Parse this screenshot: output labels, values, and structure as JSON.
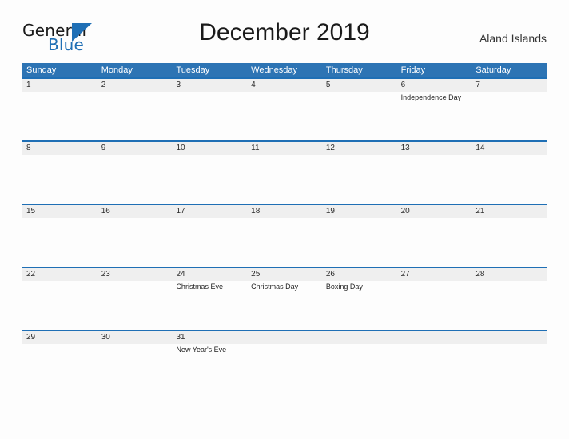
{
  "brand": {
    "name_part1": "General",
    "name_part2": "Blue",
    "accent_color": "#1f6fb5"
  },
  "header": {
    "title": "December 2019",
    "country": "Aland Islands"
  },
  "theme": {
    "header_blue": "#2d74b4",
    "row_rule_blue": "#1f6fb5",
    "date_band_gray": "#efefef",
    "page_background": "#fdfdfd"
  },
  "calendar": {
    "weekdays": [
      "Sunday",
      "Monday",
      "Tuesday",
      "Wednesday",
      "Thursday",
      "Friday",
      "Saturday"
    ],
    "weeks": [
      {
        "days": [
          {
            "date": "1",
            "event": ""
          },
          {
            "date": "2",
            "event": ""
          },
          {
            "date": "3",
            "event": ""
          },
          {
            "date": "4",
            "event": ""
          },
          {
            "date": "5",
            "event": ""
          },
          {
            "date": "6",
            "event": "Independence Day"
          },
          {
            "date": "7",
            "event": ""
          }
        ]
      },
      {
        "days": [
          {
            "date": "8",
            "event": ""
          },
          {
            "date": "9",
            "event": ""
          },
          {
            "date": "10",
            "event": ""
          },
          {
            "date": "11",
            "event": ""
          },
          {
            "date": "12",
            "event": ""
          },
          {
            "date": "13",
            "event": ""
          },
          {
            "date": "14",
            "event": ""
          }
        ]
      },
      {
        "days": [
          {
            "date": "15",
            "event": ""
          },
          {
            "date": "16",
            "event": ""
          },
          {
            "date": "17",
            "event": ""
          },
          {
            "date": "18",
            "event": ""
          },
          {
            "date": "19",
            "event": ""
          },
          {
            "date": "20",
            "event": ""
          },
          {
            "date": "21",
            "event": ""
          }
        ]
      },
      {
        "days": [
          {
            "date": "22",
            "event": ""
          },
          {
            "date": "23",
            "event": ""
          },
          {
            "date": "24",
            "event": "Christmas Eve"
          },
          {
            "date": "25",
            "event": "Christmas Day"
          },
          {
            "date": "26",
            "event": "Boxing Day"
          },
          {
            "date": "27",
            "event": ""
          },
          {
            "date": "28",
            "event": ""
          }
        ]
      },
      {
        "days": [
          {
            "date": "29",
            "event": ""
          },
          {
            "date": "30",
            "event": ""
          },
          {
            "date": "31",
            "event": "New Year's Eve"
          },
          {
            "date": "",
            "event": ""
          },
          {
            "date": "",
            "event": ""
          },
          {
            "date": "",
            "event": ""
          },
          {
            "date": "",
            "event": ""
          }
        ]
      }
    ]
  }
}
